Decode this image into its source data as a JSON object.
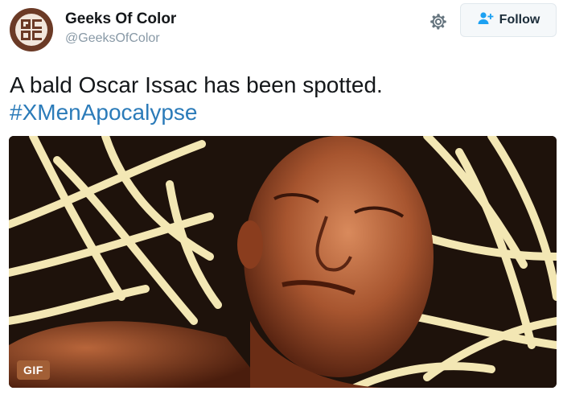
{
  "author": {
    "name": "Geeks Of Color",
    "handle": "@GeeksOfColor",
    "avatar_text": "GC"
  },
  "actions": {
    "settings_icon": "gear-icon",
    "follow_label": "Follow",
    "follow_icon": "add-user-icon"
  },
  "tweet": {
    "text": "A bald Oscar Issac has been spotted.",
    "hashtag": "#XMenApocalypse"
  },
  "media": {
    "badge": "GIF"
  },
  "colors": {
    "link": "#2b7bb9",
    "avatar_bg": "#6b3a26",
    "badge_bg": "#a25f36"
  }
}
